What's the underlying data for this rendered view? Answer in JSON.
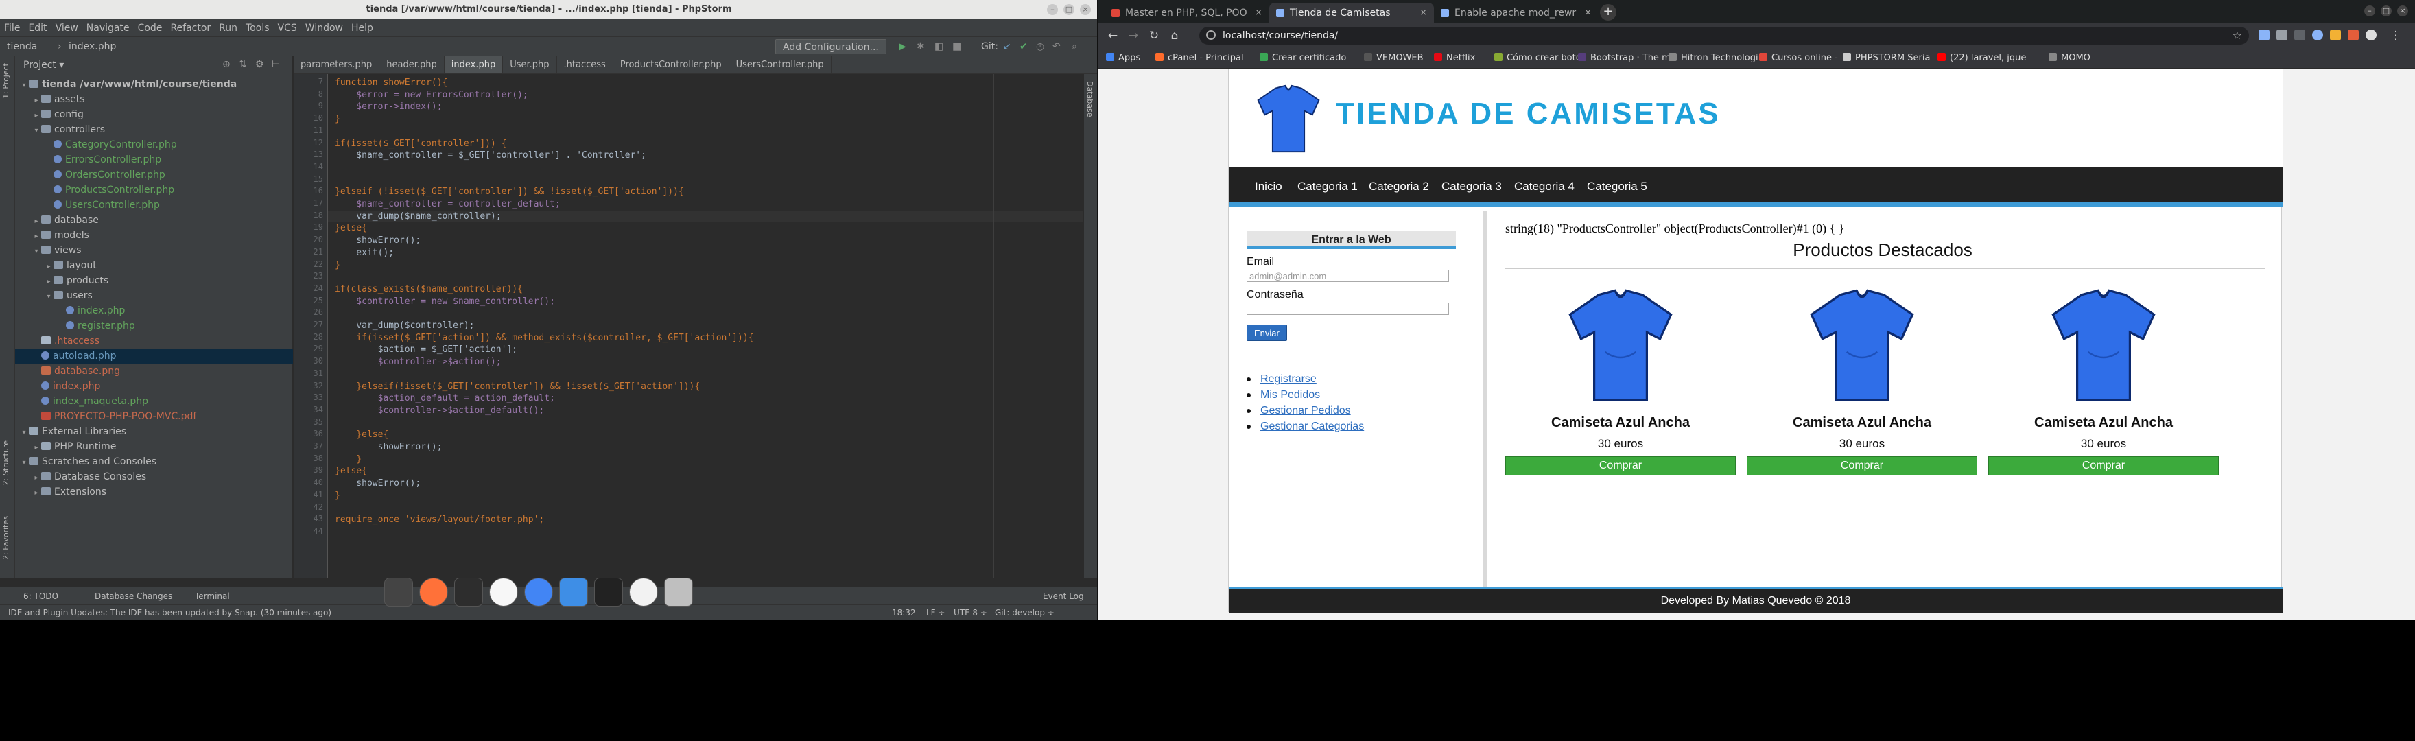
{
  "ide": {
    "title": "tienda [/var/www/html/course/tienda] - .../index.php [tienda] - PhpStorm",
    "menu": [
      "File",
      "Edit",
      "View",
      "Navigate",
      "Code",
      "Refactor",
      "Run",
      "Tools",
      "VCS",
      "Window",
      "Help"
    ],
    "breadcrumb": [
      "tienda",
      "index.php"
    ],
    "run_config": "Add Configuration...",
    "git_label": "Git:",
    "project_label": "Project",
    "tree": [
      {
        "label": "tienda  /var/www/html/course/tienda",
        "depth": 0,
        "arrow": "▾",
        "icon": "folder",
        "color": "#bbbbbb",
        "bold": true
      },
      {
        "label": "assets",
        "depth": 1,
        "arrow": "▸",
        "icon": "folder",
        "color": "#bbbbbb"
      },
      {
        "label": "config",
        "depth": 1,
        "arrow": "▸",
        "icon": "folder",
        "color": "#bbbbbb"
      },
      {
        "label": "controllers",
        "depth": 1,
        "arrow": "▾",
        "icon": "folder",
        "color": "#bbbbbb"
      },
      {
        "label": "CategoryController.php",
        "depth": 2,
        "arrow": "",
        "icon": "php",
        "color": "#62a35c"
      },
      {
        "label": "ErrorsController.php",
        "depth": 2,
        "arrow": "",
        "icon": "php",
        "color": "#62a35c"
      },
      {
        "label": "OrdersController.php",
        "depth": 2,
        "arrow": "",
        "icon": "php",
        "color": "#62a35c"
      },
      {
        "label": "ProductsController.php",
        "depth": 2,
        "arrow": "",
        "icon": "php",
        "color": "#62a35c"
      },
      {
        "label": "UsersController.php",
        "depth": 2,
        "arrow": "",
        "icon": "php",
        "color": "#62a35c"
      },
      {
        "label": "database",
        "depth": 1,
        "arrow": "▸",
        "icon": "folder",
        "color": "#bbbbbb"
      },
      {
        "label": "models",
        "depth": 1,
        "arrow": "▸",
        "icon": "folder",
        "color": "#bbbbbb"
      },
      {
        "label": "views",
        "depth": 1,
        "arrow": "▾",
        "icon": "folder",
        "color": "#bbbbbb"
      },
      {
        "label": "layout",
        "depth": 2,
        "arrow": "▸",
        "icon": "folder",
        "color": "#bbbbbb"
      },
      {
        "label": "products",
        "depth": 2,
        "arrow": "▸",
        "icon": "folder",
        "color": "#bbbbbb"
      },
      {
        "label": "users",
        "depth": 2,
        "arrow": "▾",
        "icon": "folder",
        "color": "#bbbbbb"
      },
      {
        "label": "index.php",
        "depth": 3,
        "arrow": "",
        "icon": "php",
        "color": "#62a35c"
      },
      {
        "label": "register.php",
        "depth": 3,
        "arrow": "",
        "icon": "php",
        "color": "#62a35c"
      },
      {
        "label": ".htaccess",
        "depth": 1,
        "arrow": "",
        "icon": "file",
        "color": "#c7694d"
      },
      {
        "label": "autoload.php",
        "depth": 1,
        "arrow": "",
        "icon": "php",
        "color": "#6897bb",
        "selected": true
      },
      {
        "label": "database.png",
        "depth": 1,
        "arrow": "",
        "icon": "img",
        "color": "#c7694d"
      },
      {
        "label": "index.php",
        "depth": 1,
        "arrow": "",
        "icon": "php",
        "color": "#c7694d"
      },
      {
        "label": "index_maqueta.php",
        "depth": 1,
        "arrow": "",
        "icon": "php",
        "color": "#62a35c"
      },
      {
        "label": "PROYECTO-PHP-POO-MVC.pdf",
        "depth": 1,
        "arrow": "",
        "icon": "pdf",
        "color": "#c7694d"
      },
      {
        "label": "External Libraries",
        "depth": 0,
        "arrow": "▾",
        "icon": "lib",
        "color": "#bbbbbb"
      },
      {
        "label": "PHP Runtime",
        "depth": 1,
        "arrow": "▸",
        "icon": "lib",
        "color": "#bbbbbb"
      },
      {
        "label": "Scratches and Consoles",
        "depth": 0,
        "arrow": "▾",
        "icon": "folder",
        "color": "#bbbbbb"
      },
      {
        "label": "Database Consoles",
        "depth": 1,
        "arrow": "▸",
        "icon": "folder",
        "color": "#bbbbbb"
      },
      {
        "label": "Extensions",
        "depth": 1,
        "arrow": "▸",
        "icon": "folder",
        "color": "#bbbbbb"
      }
    ],
    "tabs": [
      {
        "label": "parameters.php",
        "active": false
      },
      {
        "label": "header.php",
        "active": false
      },
      {
        "label": "index.php",
        "active": true
      },
      {
        "label": "User.php",
        "active": false
      },
      {
        "label": ".htaccess",
        "active": false
      },
      {
        "label": "ProductsController.php",
        "active": false
      },
      {
        "label": "UsersController.php",
        "active": false
      }
    ],
    "line_numbers": [
      "7",
      "8",
      "9",
      "10",
      "11",
      "12",
      "13",
      "14",
      "15",
      "16",
      "17",
      "18",
      "19",
      "20",
      "21",
      "22",
      "23",
      "24",
      "25",
      "26",
      "27",
      "28",
      "29",
      "30",
      "31",
      "32",
      "33",
      "34",
      "35",
      "36",
      "37",
      "38",
      "39",
      "40",
      "41",
      "42",
      "43",
      "44"
    ],
    "code": [
      "function showError(){",
      "    $error = new ErrorsController();",
      "    $error->index();",
      "}",
      "",
      "if(isset($_GET['controller'])) {",
      "    $name_controller = $_GET['controller'] . 'Controller';",
      "",
      "",
      "}elseif (!isset($_GET['controller']) && !isset($_GET['action'])){",
      "    $name_controller = controller_default;",
      "    var_dump($name_controller);",
      "}else{",
      "    showError();",
      "    exit();",
      "}",
      "",
      "if(class_exists($name_controller)){",
      "    $controller = new $name_controller();",
      "",
      "    var_dump($controller);",
      "    if(isset($_GET['action']) && method_exists($controller, $_GET['action'])){",
      "        $action = $_GET['action'];",
      "        $controller->$action();",
      "",
      "    }elseif(!isset($_GET['controller']) && !isset($_GET['action'])){",
      "        $action_default = action_default;",
      "        $controller->$action_default();",
      "",
      "    }else{",
      "        showError();",
      "    }",
      "}else{",
      "    showError();",
      "}",
      "",
      "require_once 'views/layout/footer.php';",
      ""
    ],
    "toolwindows": [
      "6: TODO",
      "Database Changes",
      "Terminal",
      "Event Log"
    ],
    "status_message": "IDE and Plugin Updates: The IDE has been updated by Snap. (30 minutes ago)",
    "status_right": [
      "18:32",
      "LF ÷",
      "UTF-8 ÷",
      "Git: develop ÷"
    ],
    "side_tabs": [
      "1: Project",
      "2: Structure",
      "2: Favorites",
      "Database"
    ]
  },
  "browser": {
    "tabs": [
      {
        "label": "Master en PHP, SQL, POO",
        "favicon": "#e0463a",
        "active": false
      },
      {
        "label": "Tienda de Camisetas",
        "favicon": "#8ab4f8",
        "active": true
      },
      {
        "label": "Enable apache mod_rewr",
        "favicon": "#8ab4f8",
        "active": false
      }
    ],
    "url": "localhost/course/tienda/",
    "bookmarks": [
      {
        "label": "Apps",
        "color": "#4285f4"
      },
      {
        "label": "cPanel - Principal",
        "color": "#ff6c2c"
      },
      {
        "label": "Crear certificado",
        "color": "#3aa655"
      },
      {
        "label": "VEMOWEB",
        "color": "#555555"
      },
      {
        "label": "Netflix",
        "color": "#e50914"
      },
      {
        "label": "Cómo crear botón",
        "color": "#88aa33"
      },
      {
        "label": "Bootstrap · The m",
        "color": "#563d7c"
      },
      {
        "label": "Hitron Technologi",
        "color": "#888888"
      },
      {
        "label": "Cursos online -",
        "color": "#e0463a"
      },
      {
        "label": "PHPSTORM Seria",
        "color": "#cccccc"
      },
      {
        "label": "(22) laravel, jque",
        "color": "#ff0000"
      },
      {
        "label": "MOMO",
        "color": "#888888"
      }
    ]
  },
  "site": {
    "title": "TIENDA DE CAMISETAS",
    "nav": [
      "Inicio",
      "Categoria 1",
      "Categoria 2",
      "Categoria 3",
      "Categoria 4",
      "Categoria 5"
    ],
    "login_title": "Entrar a la Web",
    "email_label": "Email",
    "email_placeholder": "admin@admin.com",
    "password_label": "Contraseña",
    "submit_label": "Enviar",
    "links": [
      "Registrarse",
      "Mis Pedidos",
      "Gestionar Pedidos",
      "Gestionar Categorias"
    ],
    "debug_output": "string(18) \"ProductsController\" object(ProductsController)#1 (0) { }",
    "section_title": "Productos Destacados",
    "products": [
      {
        "name": "Camiseta Azul Ancha",
        "price": "30 euros",
        "button": "Comprar"
      },
      {
        "name": "Camiseta Azul Ancha",
        "price": "30 euros",
        "button": "Comprar"
      },
      {
        "name": "Camiseta Azul Ancha",
        "price": "30 euros",
        "button": "Comprar"
      }
    ],
    "footer": "Developed By Matias Quevedo © 2018",
    "colors": {
      "accent": "#1ea0d9",
      "nav_bg": "#222222",
      "buy": "#3caa3c",
      "shirt": "#2f6ee8"
    }
  },
  "dock": [
    {
      "name": "workspace-switcher-icon",
      "color": "#444444"
    },
    {
      "name": "firefox-icon",
      "color": "#ff7139"
    },
    {
      "name": "terminal-icon",
      "color": "#2d2d2d"
    },
    {
      "name": "itunes-icon",
      "color": "#f7f7f7"
    },
    {
      "name": "chrome-icon",
      "color": "#4285f4"
    },
    {
      "name": "finder-icon",
      "color": "#3e8ee6"
    },
    {
      "name": "phpstorm-icon",
      "color": "#222222"
    },
    {
      "name": "photos-icon",
      "color": "#f2f2f2"
    },
    {
      "name": "trash-icon",
      "color": "#bfbfbf"
    }
  ]
}
